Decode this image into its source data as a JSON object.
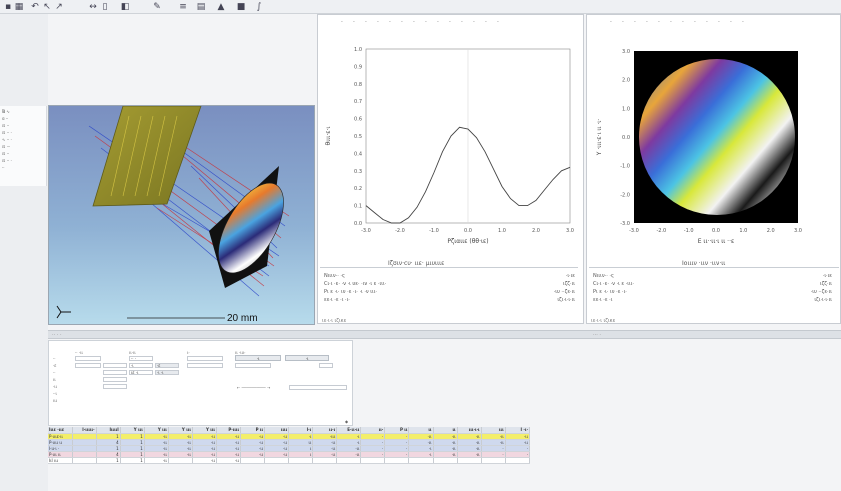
{
  "colors": {
    "plot_line": "#444444",
    "row_selected": "#f3ee6a",
    "row_blue": "#cfd9ee",
    "row_pink": "#f1d7e0",
    "row_white": "#ffffff"
  },
  "toolbar": {
    "icons": [
      "new-file-icon",
      "grid-icon",
      "undo-icon",
      "cursor-icon",
      "arrow-icon",
      "measure-icon",
      "document-icon",
      "bookmark-icon",
      "pencil-icon",
      "list-icon",
      "chart-icon",
      "triangle-icon",
      "square-icon",
      "curve-icon"
    ]
  },
  "tree": {
    "items": [
      "₪ ∿ ",
      "ɑ ·· ",
      "⊡ ·· ",
      "⊡ ·· ·",
      "∿ ·· ·",
      "⊡ ··· ",
      "⊡ ·· ",
      "⊡ ·· ·",
      "·· "
    ]
  },
  "view3d": {
    "scale_label": "20 mm"
  },
  "profile_panel": {
    "header": "Ιζʊιν·cυ· ιιε· μιυιιιε",
    "info_lines_left": [
      "Nιιιν·· ·ς",
      "Cι·ι ·ε· ·ν ·ι υε· ·ιν ·ι ε ·ιιι·",
      "Pι ε ·ι· ιν ·ε ·ι· ·ι ·ν ιιι·",
      "εε·ι ·ε ·ι ·ι·"
    ],
    "info_lines_right": [
      "·ι·ιε",
      "ιζζ·ιι",
      "·ιυ ··ζε·ιι",
      "ιζι·ι·ι·ιι"
    ],
    "status": "ιε·ι·ι ιζικε",
    "chart_data": {
      "type": "line",
      "title": "",
      "xlabel": "Ρζιαιιε (θθ·ιε)",
      "ylabel": "θιιι·ε·ι",
      "x_ticks": [
        "-3.0",
        "-2.0",
        "-1.0",
        "0.0",
        "1.0",
        "2.0",
        "3.0"
      ],
      "y_ticks": [
        "0.0",
        "0.1",
        "0.2",
        "0.3",
        "0.4",
        "0.5",
        "0.6",
        "0.7",
        "0.8",
        "0.9",
        "1.0"
      ],
      "xlim": [
        -3,
        3
      ],
      "ylim": [
        0,
        1
      ],
      "x": [
        -3.0,
        -2.75,
        -2.5,
        -2.25,
        -2.0,
        -1.75,
        -1.5,
        -1.25,
        -1.0,
        -0.75,
        -0.5,
        -0.25,
        0.0,
        0.25,
        0.5,
        0.75,
        1.0,
        1.25,
        1.5,
        1.75,
        2.0,
        2.25,
        2.5,
        2.75,
        3.0
      ],
      "y": [
        0.1,
        0.06,
        0.02,
        0.0,
        0.0,
        0.03,
        0.09,
        0.18,
        0.29,
        0.41,
        0.5,
        0.55,
        0.54,
        0.49,
        0.41,
        0.31,
        0.21,
        0.14,
        0.1,
        0.1,
        0.13,
        0.19,
        0.25,
        0.3,
        0.32
      ],
      "grid": false
    }
  },
  "map_panel": {
    "header": "Ιοιιιν ·ιιν ·ιιν·ιι",
    "info_lines_left": [
      "Nιιιν·· ·ς",
      "Cι·ι ·ε· ·ν ·ι ε ·ιιι·",
      "Pι ε ·ι· ιν ·ε ·ι·",
      "εε·ι ·ε ·ι"
    ],
    "info_lines_right": [
      "·ι·ιε",
      "ιζζ·ιι",
      "·ιυ ··ζε·ιι",
      "ιζι·ι·ι·ιι"
    ],
    "status": "ιε·ι·ι ιζικε",
    "chart_data": {
      "type": "heatmap",
      "title": "",
      "xlabel": "Ε ιι··ιι·ι ιι ··ε",
      "ylabel": "Υ ·ιιι·ε·ι ιι ·ι·",
      "x_ticks": [
        "-3.0",
        "-2.0",
        "-1.0",
        "0.0",
        "1.0",
        "2.0",
        "3.0"
      ],
      "y_ticks": [
        "-3.0",
        "-2.0",
        "-1.0",
        "0.0",
        "1.0",
        "2.0",
        "3.0"
      ],
      "xlim": [
        -3,
        3
      ],
      "ylim": [
        -3,
        3
      ]
    }
  },
  "lower_bar": {
    "left": "·· · ·",
    "right": "··· ·"
  },
  "options": {
    "group1_title": "·· ·ιι",
    "group2_title": "ιι·ιι",
    "group3_title": "ι·",
    "group4_title": "ιι ·ιιι·",
    "labels": [
      "··",
      "·ε",
      "··",
      "ιι",
      "·ιι",
      "··ι",
      "ιιι"
    ],
    "values": [
      "·· ·",
      "·ι",
      "ιε ·ι",
      "·ε",
      "·ι ·ι"
    ],
    "button1": "·ι",
    "button2": "·ι",
    "slider_label": "← ────────── →",
    "corner": "◆"
  },
  "table": {
    "headers": [
      "Ιιιε ·ιιε",
      "Ι·ιιιιι·",
      "ΙιιιιΙ",
      "Υ ιιι",
      "Υ ιιι",
      "Υ ιιι",
      "Υ ιιι",
      "Ρ·ιιιι",
      "Ρ ιι",
      "ιιιι",
      "Ι·ι",
      "ιι·ι",
      "Ε·ιι·ιι",
      "ιι·",
      "Ρ ιι",
      "ιι",
      "ιι",
      "ιιι·ι·ι",
      "ιιι",
      "Ι ·ι·"
    ],
    "rows": [
      {
        "style": "row_selected",
        "cells": [
          "Ρ·ιιιε·ιι",
          "",
          "1",
          "1",
          "·ιι",
          "·ιι",
          "·ιι",
          "·ιι",
          "·ιι",
          "·ιι",
          "·ι",
          "·ιιι",
          "·ι",
          "·",
          "·",
          "·ιι",
          "·ιι",
          "·ιι",
          "·ιι",
          "·ιι"
        ]
      },
      {
        "style": "row_blue",
        "cells": [
          "Ρ·ιιιι ιι",
          "",
          "4",
          "1",
          "·ιι",
          "·ιι",
          "·ιι",
          "·ιι",
          "·ιι",
          "·ιι",
          "ιι",
          "·ιι",
          "·ι",
          "·",
          "·",
          "·ιι",
          "·ιι",
          "·ιι",
          "·ιι",
          "·ιι"
        ]
      },
      {
        "style": "row_blue",
        "cells": [
          "Ι·ιι·ι ·",
          "",
          "1",
          "1",
          "·ιι",
          "·ιι",
          "·ιι",
          "·ιι",
          "·ιι",
          "·ιι",
          "ι",
          "·ιι",
          "·ιι",
          "·",
          "·",
          "·ι",
          "·ιι",
          "·ιι",
          "·",
          "·"
        ]
      },
      {
        "style": "row_pink",
        "cells": [
          "Ρ·ιιι ιι",
          "",
          "4",
          "1",
          "·ιι",
          "·ιι",
          "·ιι",
          "·ιι",
          "·ιι",
          "·ιι",
          "ι",
          "·ιι",
          "·ιι",
          "·",
          "·",
          "·ι",
          "·ιι",
          "·ιι",
          "·",
          "·"
        ]
      },
      {
        "style": "row_white",
        "cells": [
          "ΙιΙ ιιι",
          "",
          "1",
          "1",
          "·ιι",
          "",
          "·ιι",
          "·ιι",
          "",
          "",
          "",
          "",
          "",
          "",
          "",
          "",
          "",
          "",
          "",
          ""
        ]
      }
    ]
  }
}
